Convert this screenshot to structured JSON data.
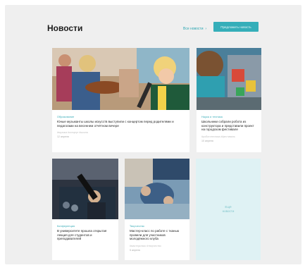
{
  "header": {
    "title": "Новости",
    "all_link": "Все новости",
    "suggest_button": "Предложить новость"
  },
  "cards": [
    {
      "category": "Образование",
      "title": "Юные музыканты школы искусств выступили с концертом перед родителями и педагогами на весеннем отчётном вечере",
      "tags": "#музыка #концерт #школа",
      "date": "12 апреля"
    },
    {
      "category": "Наука и техника",
      "title": "Школьники собрали робота из конструктора и представили проект на городском фестивале",
      "tags": "#робототехника #фестиваль",
      "date": "10 апреля"
    },
    {
      "category": "Конференция",
      "title": "В университете прошла открытая лекция для студентов и преподавателей",
      "tags": "",
      "date": ""
    },
    {
      "category": "Творчество",
      "title": "Мастер-класс по работе с тканью провели для участников молодёжного клуба",
      "tags": "#мастеркласс #творчество",
      "date": "5 апреля"
    }
  ],
  "more": {
    "line1": "Ещё",
    "line2": "новости"
  },
  "colors": {
    "accent": "#35aeb9",
    "background": "#efefef",
    "more_card": "#dff2f4"
  }
}
